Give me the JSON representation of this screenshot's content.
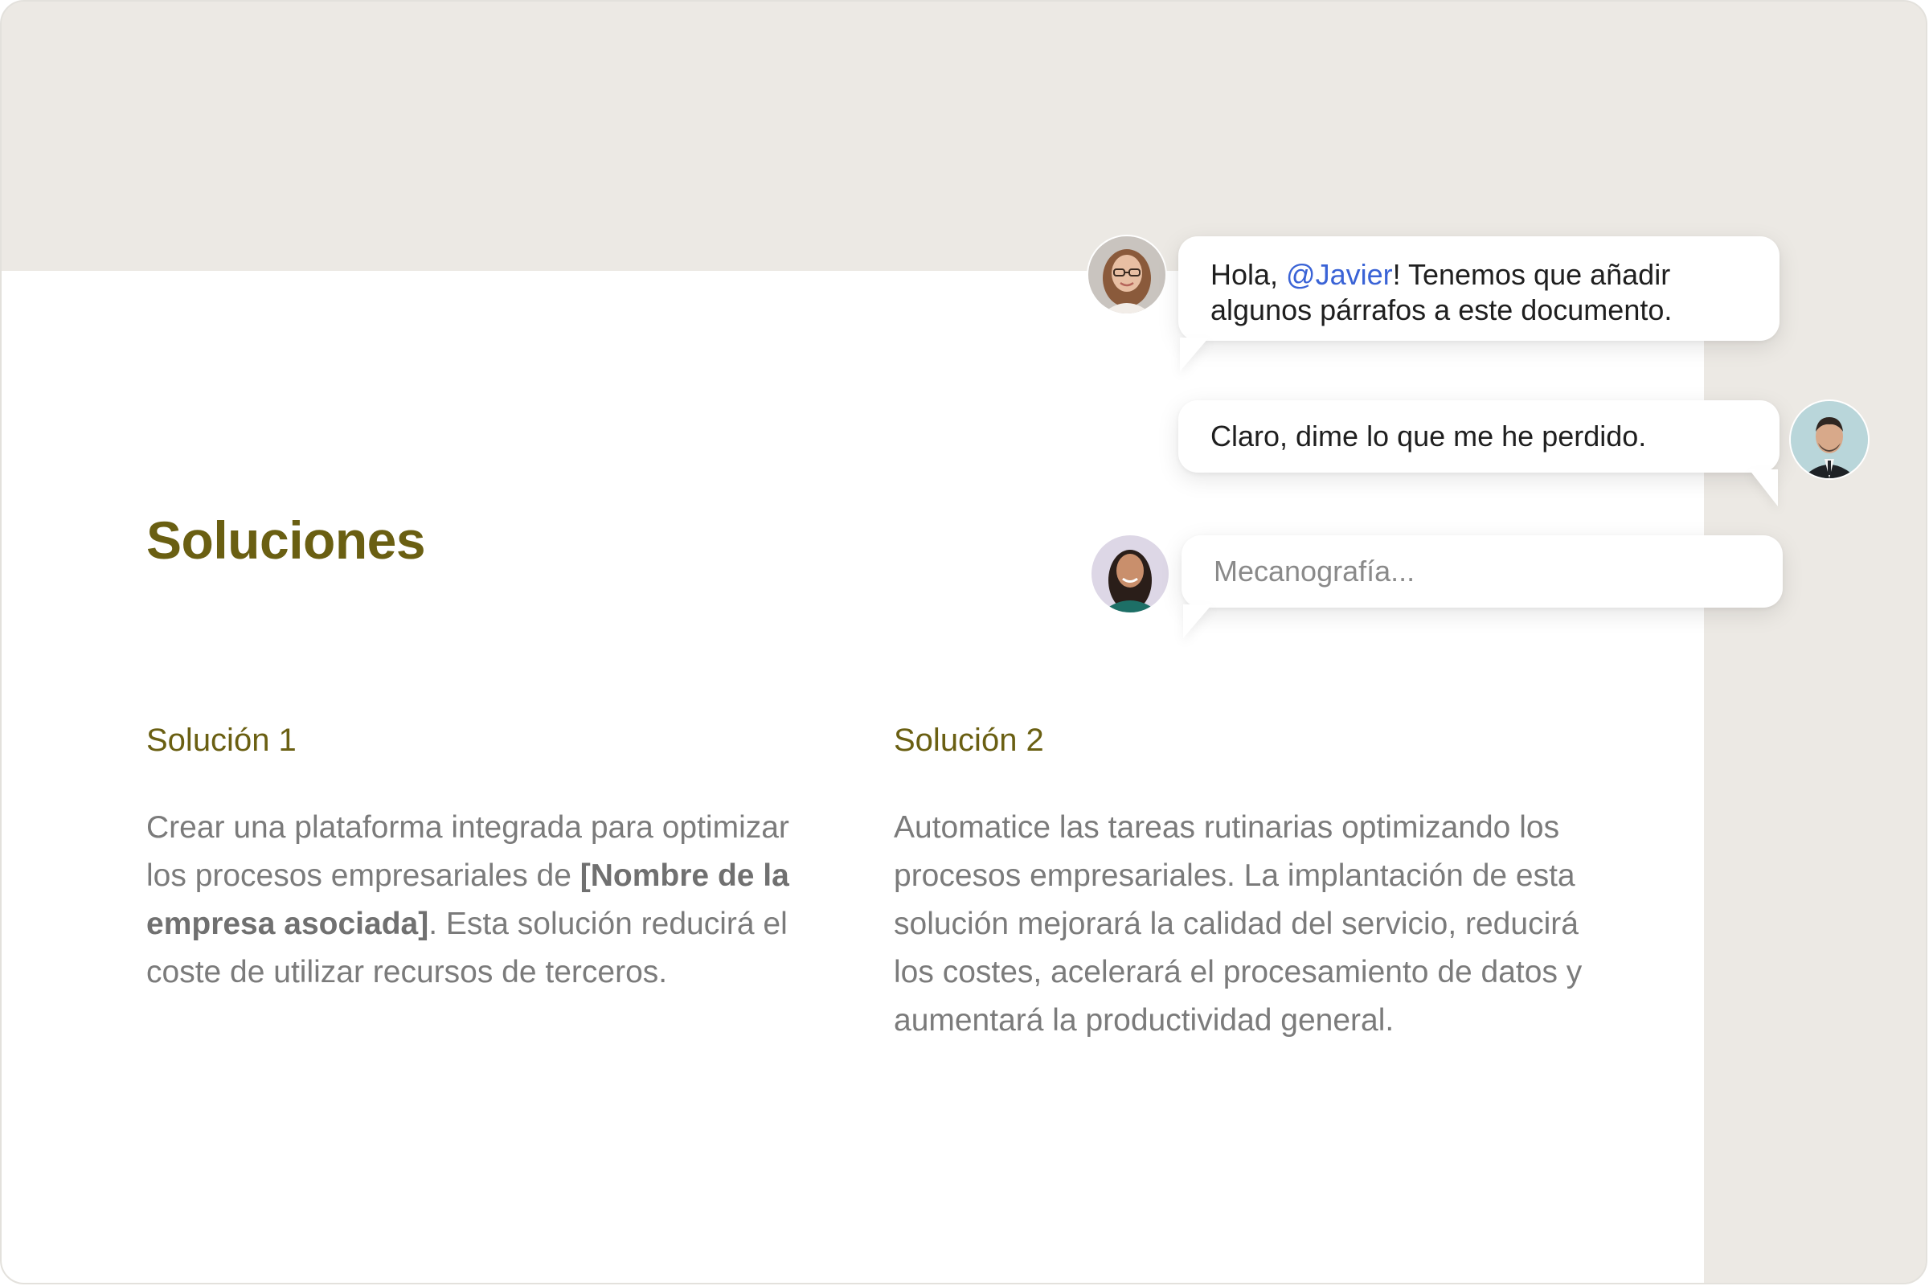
{
  "document": {
    "section_title": "Soluciones",
    "columns": [
      {
        "title": "Solución 1",
        "body_before": "Crear una plataforma integrada para optimizar los procesos empresariales de ",
        "body_bold": "[Nombre de la empresa asociada]",
        "body_after": ". Esta solución reducirá el coste de utilizar recursos de terceros."
      },
      {
        "title": "Solución 2",
        "body": "Automatice las tareas rutinarias optimizando los procesos empresariales. La implantación de esta solución mejorará la calidad del servicio, reducirá los costes, acelerará el procesamiento de datos y aumentará la productividad general."
      }
    ]
  },
  "chat": {
    "messages": [
      {
        "avatar": "woman-glasses-avatar",
        "text_before": "Hola, ",
        "mention": "@Javier",
        "text_after": "! Tenemos que añadir algunos párrafos a este documento."
      },
      {
        "avatar": "man-suit-avatar",
        "text": "Claro, dime lo que me he perdido."
      }
    ],
    "input": {
      "avatar": "woman-green-top-avatar",
      "placeholder": "Mecanografía...",
      "value": ""
    }
  },
  "colors": {
    "accent_olive": "#6a5f12",
    "mention_blue": "#3a63d6",
    "background_beige": "#ece9e4",
    "body_text_gray": "#7b7b7b"
  }
}
